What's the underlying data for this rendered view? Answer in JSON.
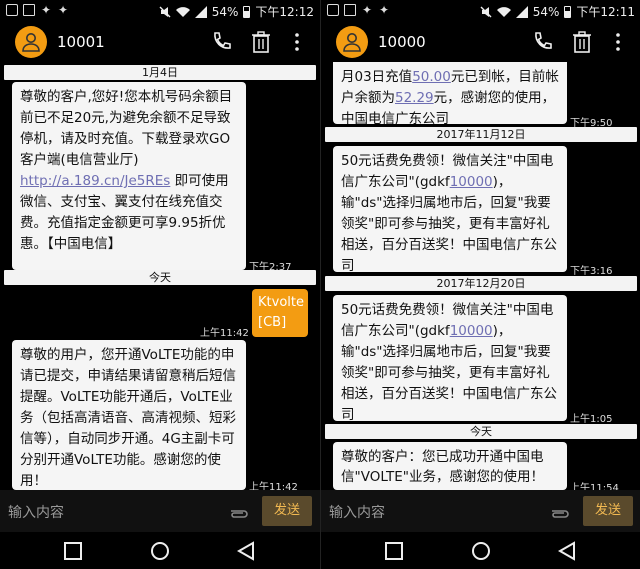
{
  "left": {
    "status": {
      "battery": "54%",
      "time": "下午12:12"
    },
    "contact": "10001",
    "dates": [
      "1月4日",
      "今天"
    ],
    "messages": [
      {
        "text_1": "尊敬的客户,您好!您本机号码余额目前已不足20元,为避免余额不足导致停机，请及时充值。下载登录欢GO客户端(电信营业厅)\n",
        "link": "http://a.189.cn/Je5REs",
        "text_2": " 即可使用微信、支付宝、翼支付在线充值交费。充值指定金额更可享9.95折优惠。【中国电信】",
        "time": "下午2:37"
      },
      {
        "text": "Ktvolte\n[CB]",
        "time": "上午11:42"
      },
      {
        "text": "尊敬的用户，您开通VoLTE功能的申请已提交，申请结果请留意稍后短信提醒。VoLTE功能开通后，VoLTE业务（包括高清语音、高清视频、短彩信等），自动同步开通。4G主副卡可分别开通VoLTE功能。感谢您的使用！",
        "time": "上午11:42"
      }
    ]
  },
  "right": {
    "status": {
      "battery": "54%",
      "time": "下午12:11"
    },
    "contact": "10000",
    "dates": [
      "2017年11月12日",
      "2017年12月20日",
      "今天"
    ],
    "messages": [
      {
        "p1": "月03日充值",
        "l1": "50.00",
        "p2": "元已到帐，目前帐户余额为",
        "l2": "52.29",
        "p3": "元，感谢您的使用，中国电信广东公司",
        "time": "下午9:50"
      },
      {
        "p1": "50元话费免费领！微信关注\"中国电信广东公司\"(gdkf",
        "l1": "10000",
        "p2": ")，输\"ds\"选择归属地市后，回复\"我要领奖\"即可参与抽奖，更有丰富好礼相送，百分百送奖！中国电信广东公司",
        "time": "下午3:16"
      },
      {
        "p1": "50元话费免费领！微信关注\"中国电信广东公司\"(gdkf",
        "l1": "10000",
        "p2": ")，输\"ds\"选择归属地市后，回复\"我要领奖\"即可参与抽奖，更有丰富好礼相送，百分百送奖！中国电信广东公司",
        "time": "上午1:05"
      },
      {
        "text": "尊敬的客户：您已成功开通中国电信\"VOLTE\"业务，感谢您的使用！",
        "time": "上午11:54"
      }
    ]
  },
  "composer": {
    "placeholder": "输入内容",
    "send": "发送"
  },
  "icons": [
    "chat-icon",
    "image-icon",
    "twitter-icon",
    "mute-icon",
    "wifi-icon",
    "signal-icon",
    "battery-icon",
    "avatar-icon",
    "call-icon",
    "trash-icon",
    "more-icon",
    "attach-icon",
    "recent-apps-icon",
    "home-icon",
    "back-icon"
  ],
  "colors": {
    "accent": "#f39c12",
    "send_bg": "#5a4a2c",
    "link": "#6f6fb3"
  }
}
